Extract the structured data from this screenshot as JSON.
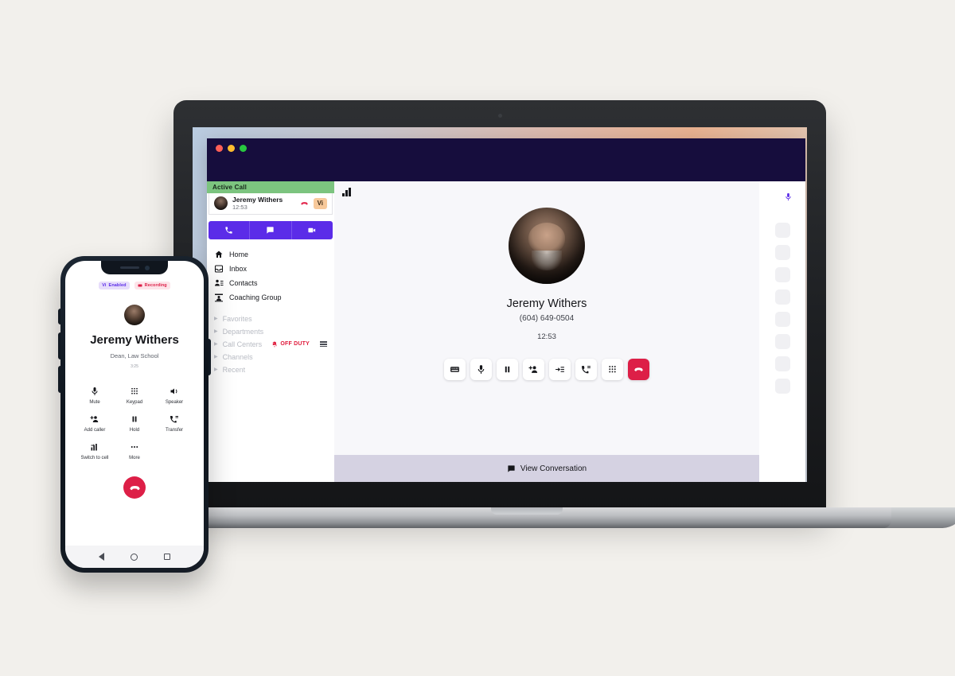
{
  "background_color": "#f2f0ec",
  "desktop": {
    "app_window": {
      "titlebar": {
        "color": "#160d3d",
        "traffic_lights": [
          "close",
          "minimize",
          "maximize"
        ]
      },
      "sidebar": {
        "active_call_header": "Active Call",
        "call_card": {
          "name": "Jeremy Withers",
          "duration": "12:53",
          "hangup_icon": "hangup-icon",
          "vi_badge": "Vi",
          "vi_badge_color": "#f7c99b"
        },
        "action_bar": {
          "color": "#5b2ce8",
          "buttons": [
            {
              "name": "call",
              "icon": "phone-icon"
            },
            {
              "name": "message",
              "icon": "message-icon"
            },
            {
              "name": "video",
              "icon": "video-icon"
            }
          ]
        },
        "nav_items": [
          {
            "label": "Home",
            "icon": "home-icon"
          },
          {
            "label": "Inbox",
            "icon": "inbox-icon"
          },
          {
            "label": "Contacts",
            "icon": "contacts-icon"
          },
          {
            "label": "Coaching Group",
            "icon": "coaching-group-icon"
          }
        ],
        "groups": [
          {
            "label": "Favorites"
          },
          {
            "label": "Departments"
          },
          {
            "label": "Call Centers",
            "status": "OFF DUTY",
            "status_color": "#e01b3c",
            "status_icon": "bell-off-icon"
          },
          {
            "label": "Channels"
          },
          {
            "label": "Recent"
          }
        ]
      },
      "main": {
        "signal_icon": "signal-bars-icon",
        "mic_icon": "microphone-icon",
        "contact_name": "Jeremy Withers",
        "phone_number": "(604) 649-0504",
        "timer": "12:53",
        "controls": [
          {
            "name": "keyboard",
            "icon": "keyboard-icon"
          },
          {
            "name": "mute",
            "icon": "microphone-icon"
          },
          {
            "name": "hold",
            "icon": "pause-icon"
          },
          {
            "name": "add-caller",
            "icon": "add-person-icon"
          },
          {
            "name": "transfer",
            "icon": "transfer-icon"
          },
          {
            "name": "forward",
            "icon": "phone-forward-icon"
          },
          {
            "name": "keypad",
            "icon": "dialpad-icon"
          },
          {
            "name": "end-call",
            "icon": "hangup-icon",
            "color": "#dd1f47"
          }
        ],
        "view_conversation": {
          "label": "View Conversation",
          "icon": "message-icon"
        }
      },
      "right_rail": {
        "placeholder_count": 8
      }
    }
  },
  "phone": {
    "badges": [
      {
        "label": "Enabled",
        "prefix": "Vi",
        "color": "#5b2ce8"
      },
      {
        "label": "Recording",
        "icon": "record-icon",
        "color": "#dd1f47"
      }
    ],
    "contact_name": "Jeremy Withers",
    "contact_role": "Dean, Law School",
    "timer": "3:25",
    "controls": [
      {
        "label": "Mute",
        "icon": "microphone-icon"
      },
      {
        "label": "Keypad",
        "icon": "dialpad-icon"
      },
      {
        "label": "Speaker",
        "icon": "speaker-icon"
      },
      {
        "label": "Add caller",
        "icon": "add-person-icon"
      },
      {
        "label": "Hold",
        "icon": "pause-icon"
      },
      {
        "label": "Transfer",
        "icon": "phone-forward-icon"
      },
      {
        "label": "Switch to cell",
        "icon": "switch-device-icon"
      },
      {
        "label": "More",
        "icon": "more-icon"
      }
    ],
    "end_call": {
      "name": "end-call",
      "icon": "hangup-icon",
      "color": "#dd1f47"
    },
    "nav_bar": [
      "back",
      "home",
      "recents"
    ]
  }
}
